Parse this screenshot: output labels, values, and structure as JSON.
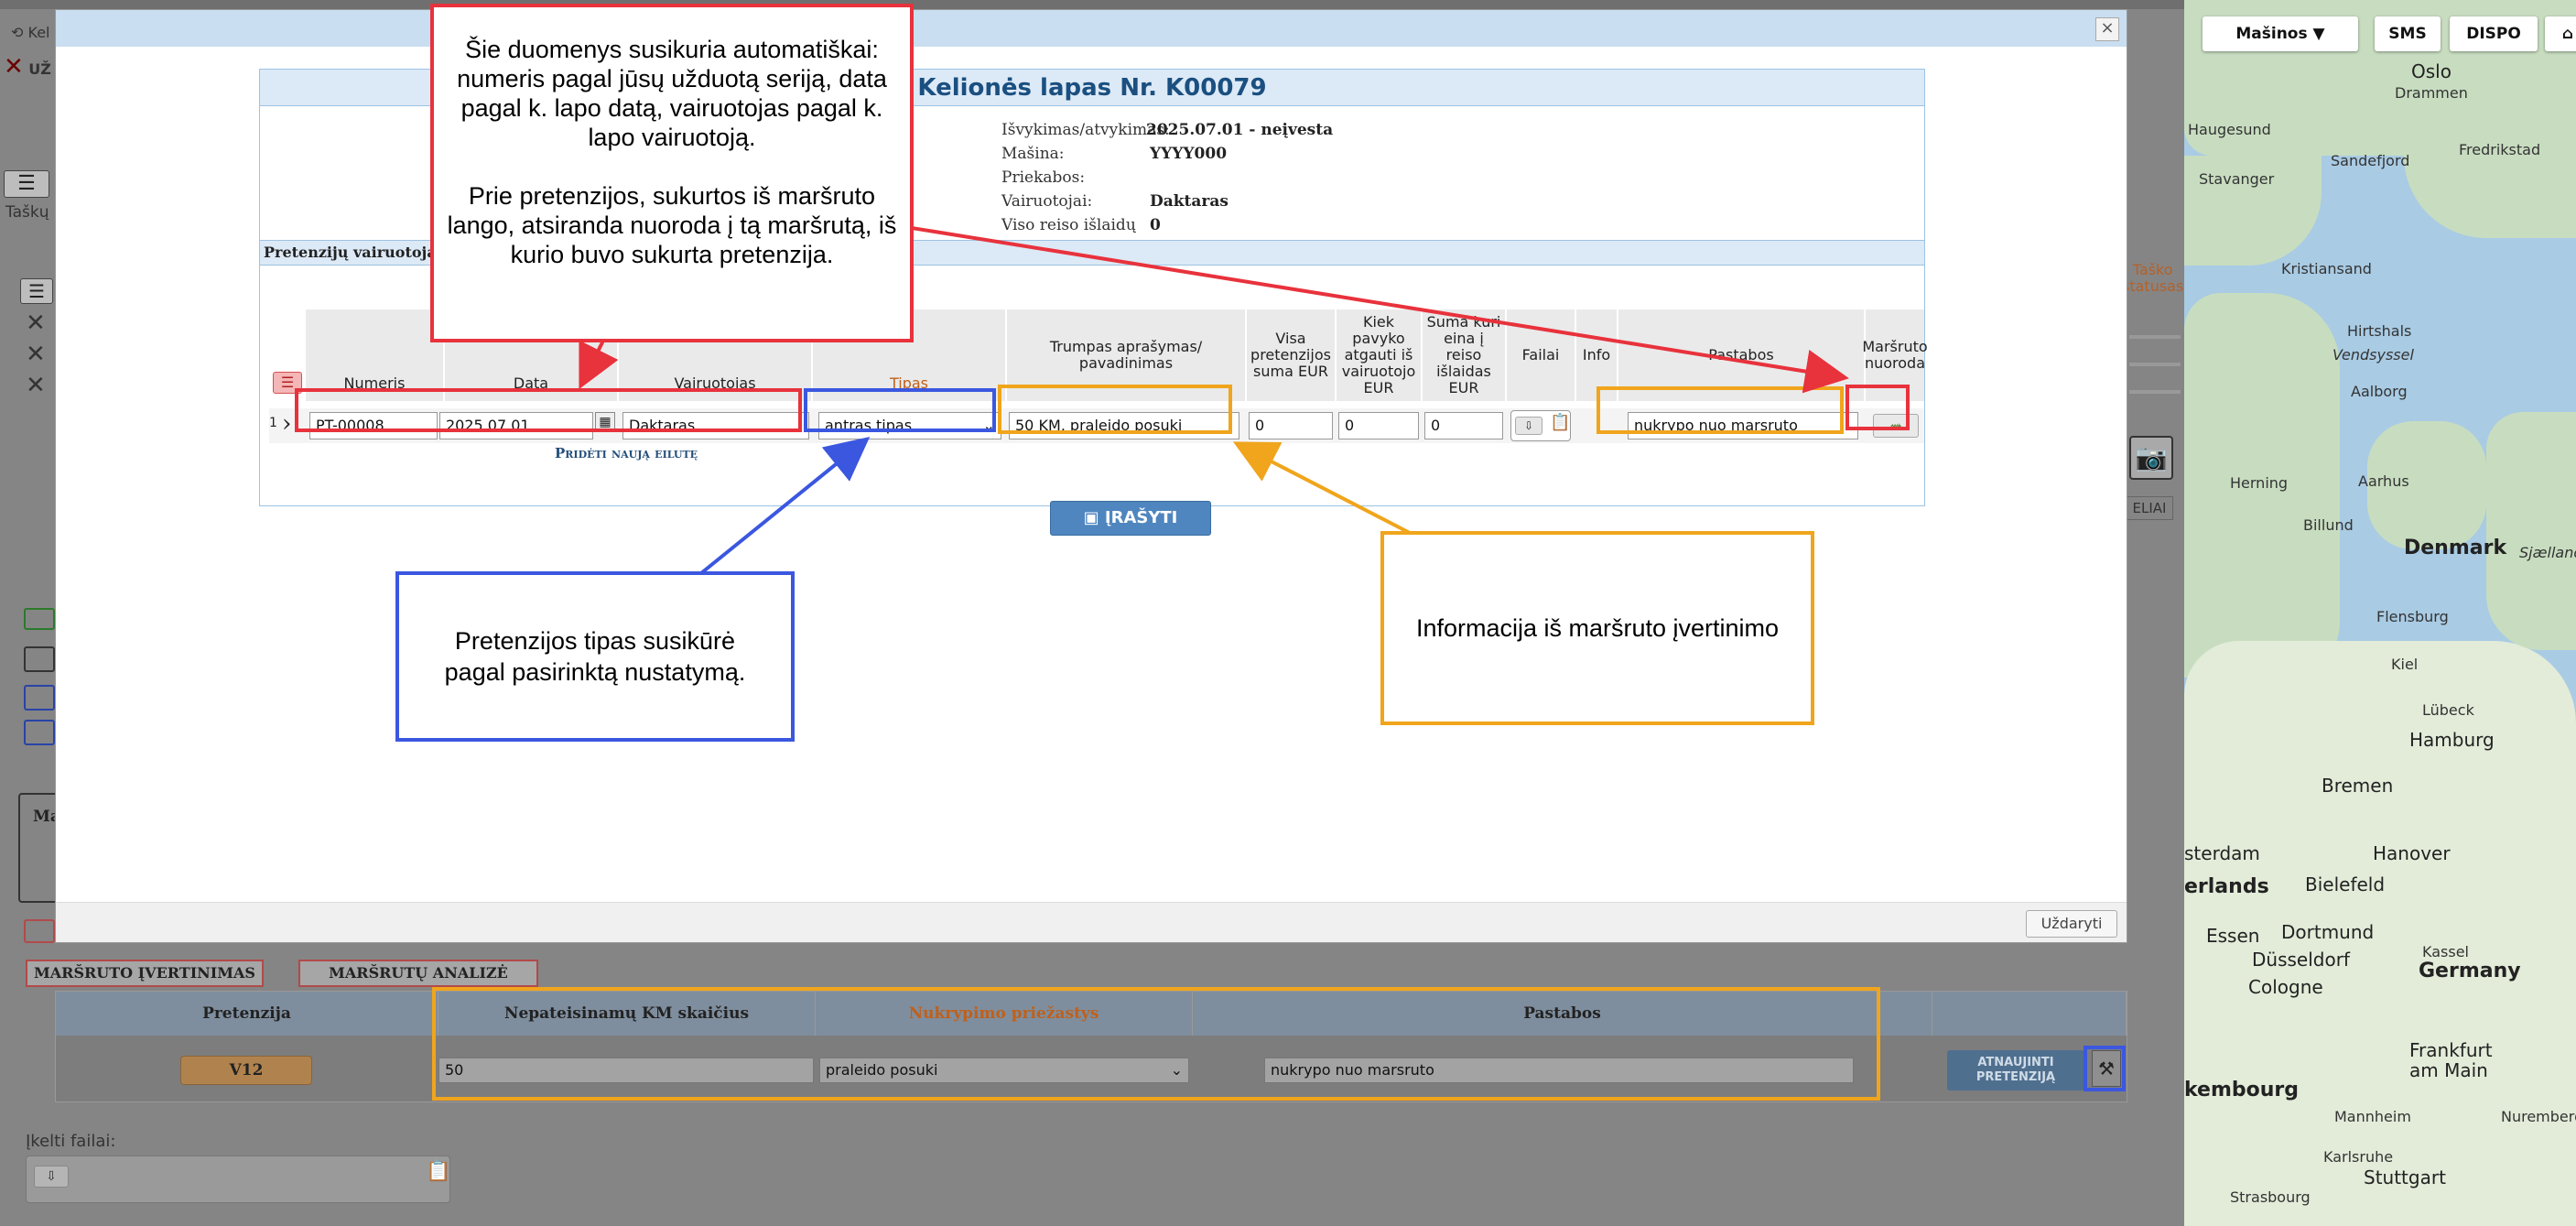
{
  "background": {
    "tab_label": "Kel",
    "close_label": "UŽ",
    "side_label": "Taškų",
    "right_labels": [
      "Taško",
      "statusas"
    ],
    "right_btn": "ELIAI",
    "marker_label": "Ma",
    "buttons": [
      "MARŠRUTO ĮVERTINIMAS",
      "MARŠRUTŲ ANALIZĖ"
    ],
    "claim_table": {
      "headers": [
        "Pretenzija",
        "Nepateisinamų KM skaičius",
        "Nukrypimo priežastys",
        "Pastabos"
      ],
      "claim_code": "V12",
      "km_value": "50",
      "reason_value": "praleido posuki",
      "note_value": "nukrypo nuo marsruto",
      "refresh_button": "ATNAUJINTI PRETENZIJĄ"
    },
    "uploaded_files_label": "Įkelti failai:"
  },
  "map": {
    "buttons": [
      "Mašinos ▼",
      "SMS",
      "DISPO"
    ],
    "cities": [
      "Oslo",
      "Drammen",
      "Haugesund",
      "Sandefjord",
      "Fredrikstad",
      "Stavanger",
      "Kristiansand",
      "Hirtshals",
      "Vendsyssel",
      "Aalborg",
      "Herning",
      "Aarhus",
      "Billund",
      "Denmark",
      "Sjælland",
      "Flensburg",
      "Kiel",
      "Lübeck",
      "Hamburg",
      "Bremen",
      "sterdam",
      "erlands",
      "Hanover",
      "Bielefeld",
      "Essen",
      "Dortmund",
      "Düsseldorf",
      "Kassel",
      "Cologne",
      "Germany",
      "Frankfurt am Main",
      "kembourg",
      "Mannheim",
      "Nuremberg",
      "Karlsruhe",
      "Stuttgart",
      "Strasbourg"
    ]
  },
  "modal": {
    "title": "Kelionės lapas Nr. K00079",
    "close_x": "×",
    "info": [
      {
        "label": "Išvykimas/atvykimas:",
        "value": "2025.07.01 - neįvesta"
      },
      {
        "label": "Mašina:",
        "value": "YYYY000"
      },
      {
        "label": "Priekabos:",
        "value": ""
      },
      {
        "label": "Vairuotojai:",
        "value": "Daktaras"
      },
      {
        "label": "Viso reiso išlaidų",
        "value": "0"
      }
    ],
    "claims_section_title": "Pretenzijų vairuotojam",
    "table_headers": {
      "number": "Numeris",
      "date": "Data",
      "driver": "Vairuotojas",
      "type": "Tipas",
      "description": "Trumpas aprašymas/ pavadinimas",
      "total": "Visa pretenzijos suma EUR",
      "recovered": "Kiek pavyko atgauti iš vairuotojo EUR",
      "expenses": "Suma kuri eina į reiso išlaidas EUR",
      "files": "Failai",
      "info": "Info",
      "notes": "Pastabos",
      "route_link": "Maršruto nuoroda"
    },
    "row": {
      "index": "1",
      "number": "PT-00008",
      "date": "2025.07.01",
      "driver": "Daktaras",
      "type": "antras tipas",
      "description": "50 KM, praleido posuki",
      "total": "0",
      "recovered": "0",
      "expenses": "0",
      "notes": "nukrypo nuo marsruto"
    },
    "add_row_label": "Pridėti naują eilutę",
    "save_button": "ĮRAŠYTI",
    "close_button": "Uždaryti"
  },
  "annotations": {
    "red_callout": "Šie duomenys susikuria automatiškai: numeris pagal jūsų užduotą seriją, data pagal k. lapo datą, vairuotojas pagal k. lapo vairuotoją.\n\nPrie pretenzijos, sukurtos iš maršruto lango, atsiranda nuoroda į tą maršrutą, iš kurio buvo sukurta pretenzija.",
    "blue_callout": "Pretenzijos tipas susikūrė pagal pasirinktą nustatymą.",
    "orange_callout": "Informacija iš maršruto įvertinimo"
  },
  "colors": {
    "annotation_red": "#e8323c",
    "annotation_blue": "#3b57e0",
    "annotation_orange": "#f0a51c",
    "modal_header": "#c9def0",
    "title_text": "#1a4f80",
    "save_button": "#4f86bf"
  }
}
